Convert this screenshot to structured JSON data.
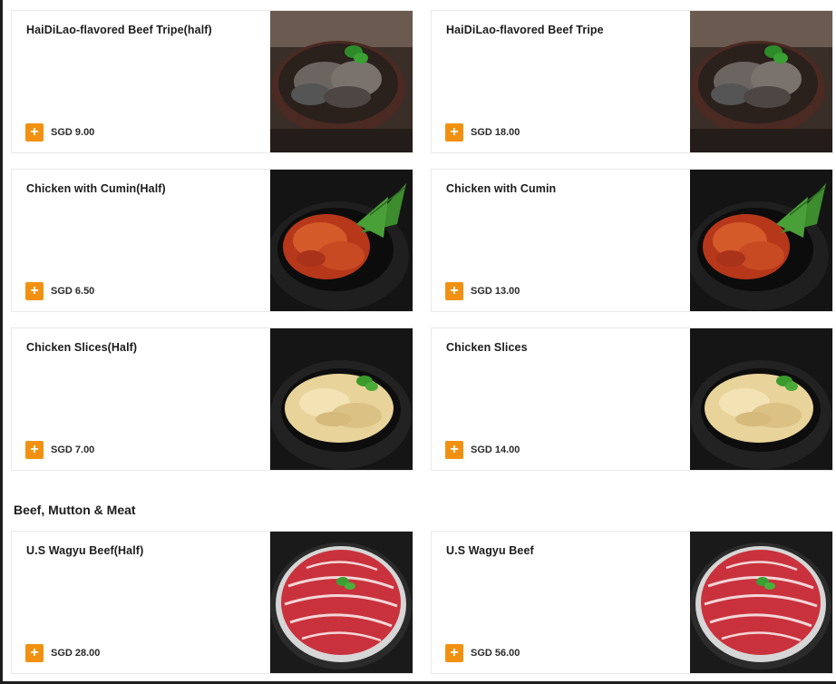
{
  "items": [
    {
      "name": "HaiDiLao-flavored Beef Tripe(half)",
      "price": "SGD 9.00",
      "add_label": "+",
      "photo": "beef-tripe-photo"
    },
    {
      "name": "HaiDiLao-flavored Beef Tripe",
      "price": "SGD 18.00",
      "add_label": "+",
      "photo": "beef-tripe-photo"
    },
    {
      "name": "Chicken with Cumin(Half)",
      "price": "SGD 6.50",
      "add_label": "+",
      "photo": "cumin-chicken-photo"
    },
    {
      "name": "Chicken with Cumin",
      "price": "SGD 13.00",
      "add_label": "+",
      "photo": "cumin-chicken-photo"
    },
    {
      "name": "Chicken Slices(Half)",
      "price": "SGD 7.00",
      "add_label": "+",
      "photo": "chicken-slices-photo"
    },
    {
      "name": "Chicken Slices",
      "price": "SGD 14.00",
      "add_label": "+",
      "photo": "chicken-slices-photo"
    },
    {
      "name": "U.S Wagyu Beef(Half)",
      "price": "SGD 28.00",
      "add_label": "+",
      "photo": "wagyu-beef-photo"
    },
    {
      "name": "U.S Wagyu Beef",
      "price": "SGD 56.00",
      "add_label": "+",
      "photo": "wagyu-beef-photo"
    }
  ],
  "section": {
    "title": "Beef, Mutton & Meat"
  },
  "colors": {
    "accent": "#f29111",
    "text": "#1c1c1c",
    "card_border": "#e9e9e9"
  }
}
